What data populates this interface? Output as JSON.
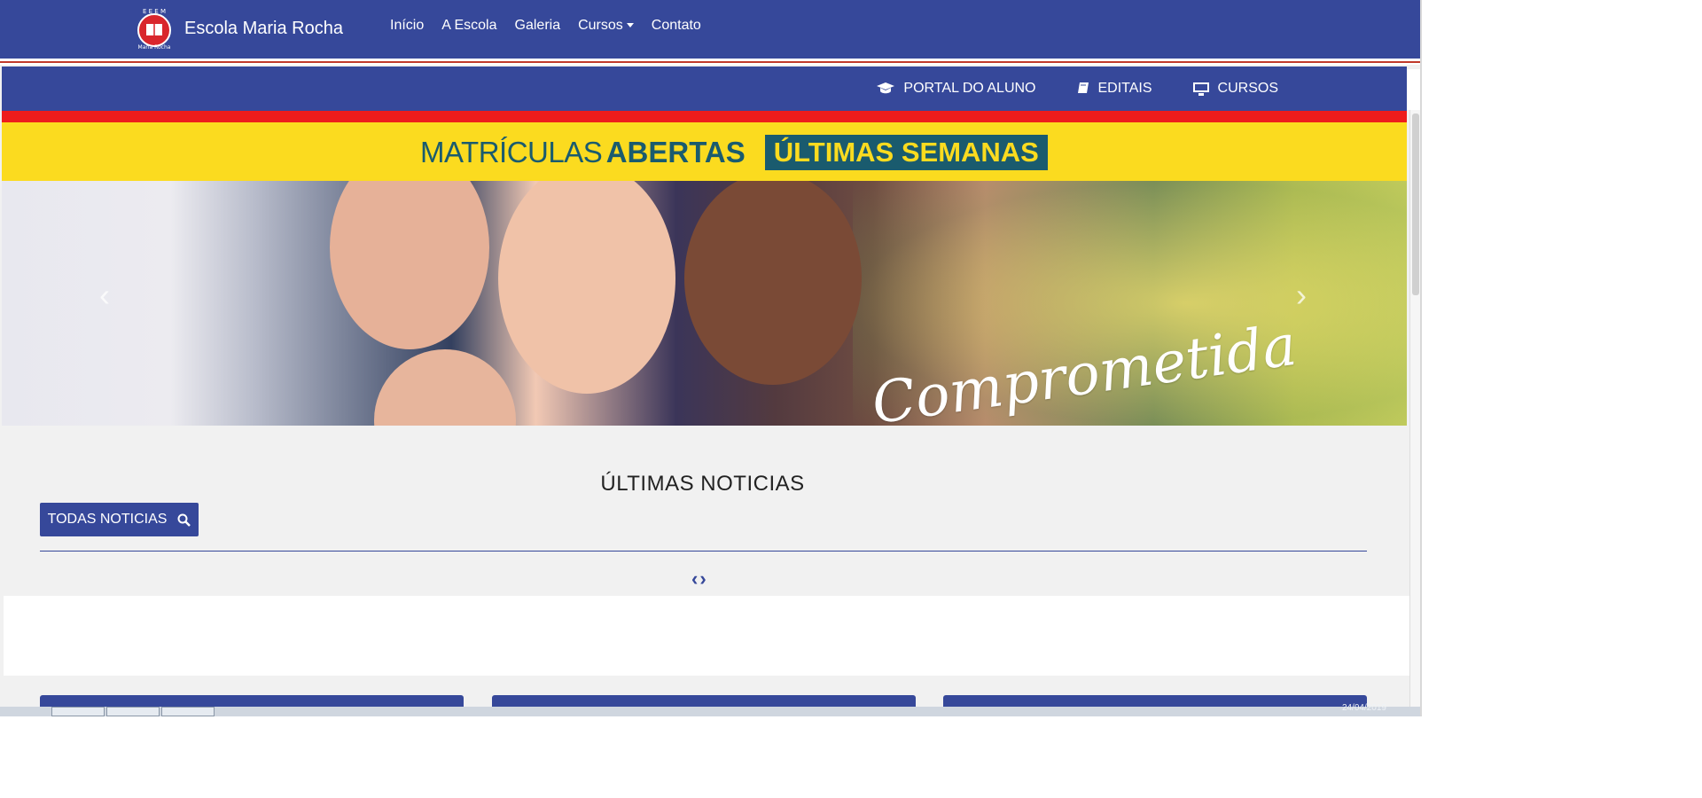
{
  "topnav": {
    "brand": "Escola Maria Rocha",
    "menu": [
      {
        "label": "Início"
      },
      {
        "label": "A Escola"
      },
      {
        "label": "Galeria"
      },
      {
        "label": "Cursos",
        "dropdown": true
      },
      {
        "label": "Contato"
      }
    ]
  },
  "subbar": {
    "links": [
      {
        "label": "PORTAL DO ALUNO",
        "icon": "graduation-cap-icon"
      },
      {
        "label": "EDITAIS",
        "icon": "book-icon"
      },
      {
        "label": "CURSOS",
        "icon": "desktop-icon"
      }
    ]
  },
  "banner": {
    "thin": "MATRÍCULAS",
    "bold": "ABERTAS",
    "highlight": "ÚLTIMAS SEMANAS",
    "tagline": "Comprometida"
  },
  "carousel": {
    "prev_symbol": "‹",
    "next_symbol": "›"
  },
  "news": {
    "title": "ÚLTIMAS NOTICIAS",
    "all_button": "TODAS NOTICIAS",
    "pager_prev": "‹",
    "pager_next": "›"
  },
  "colors": {
    "primary": "#36489a",
    "red": "#ee1c1c",
    "yellow": "#fbdb1f",
    "teal": "#1a5b6e"
  },
  "taskbar": {
    "clock": "24/04/2019"
  }
}
